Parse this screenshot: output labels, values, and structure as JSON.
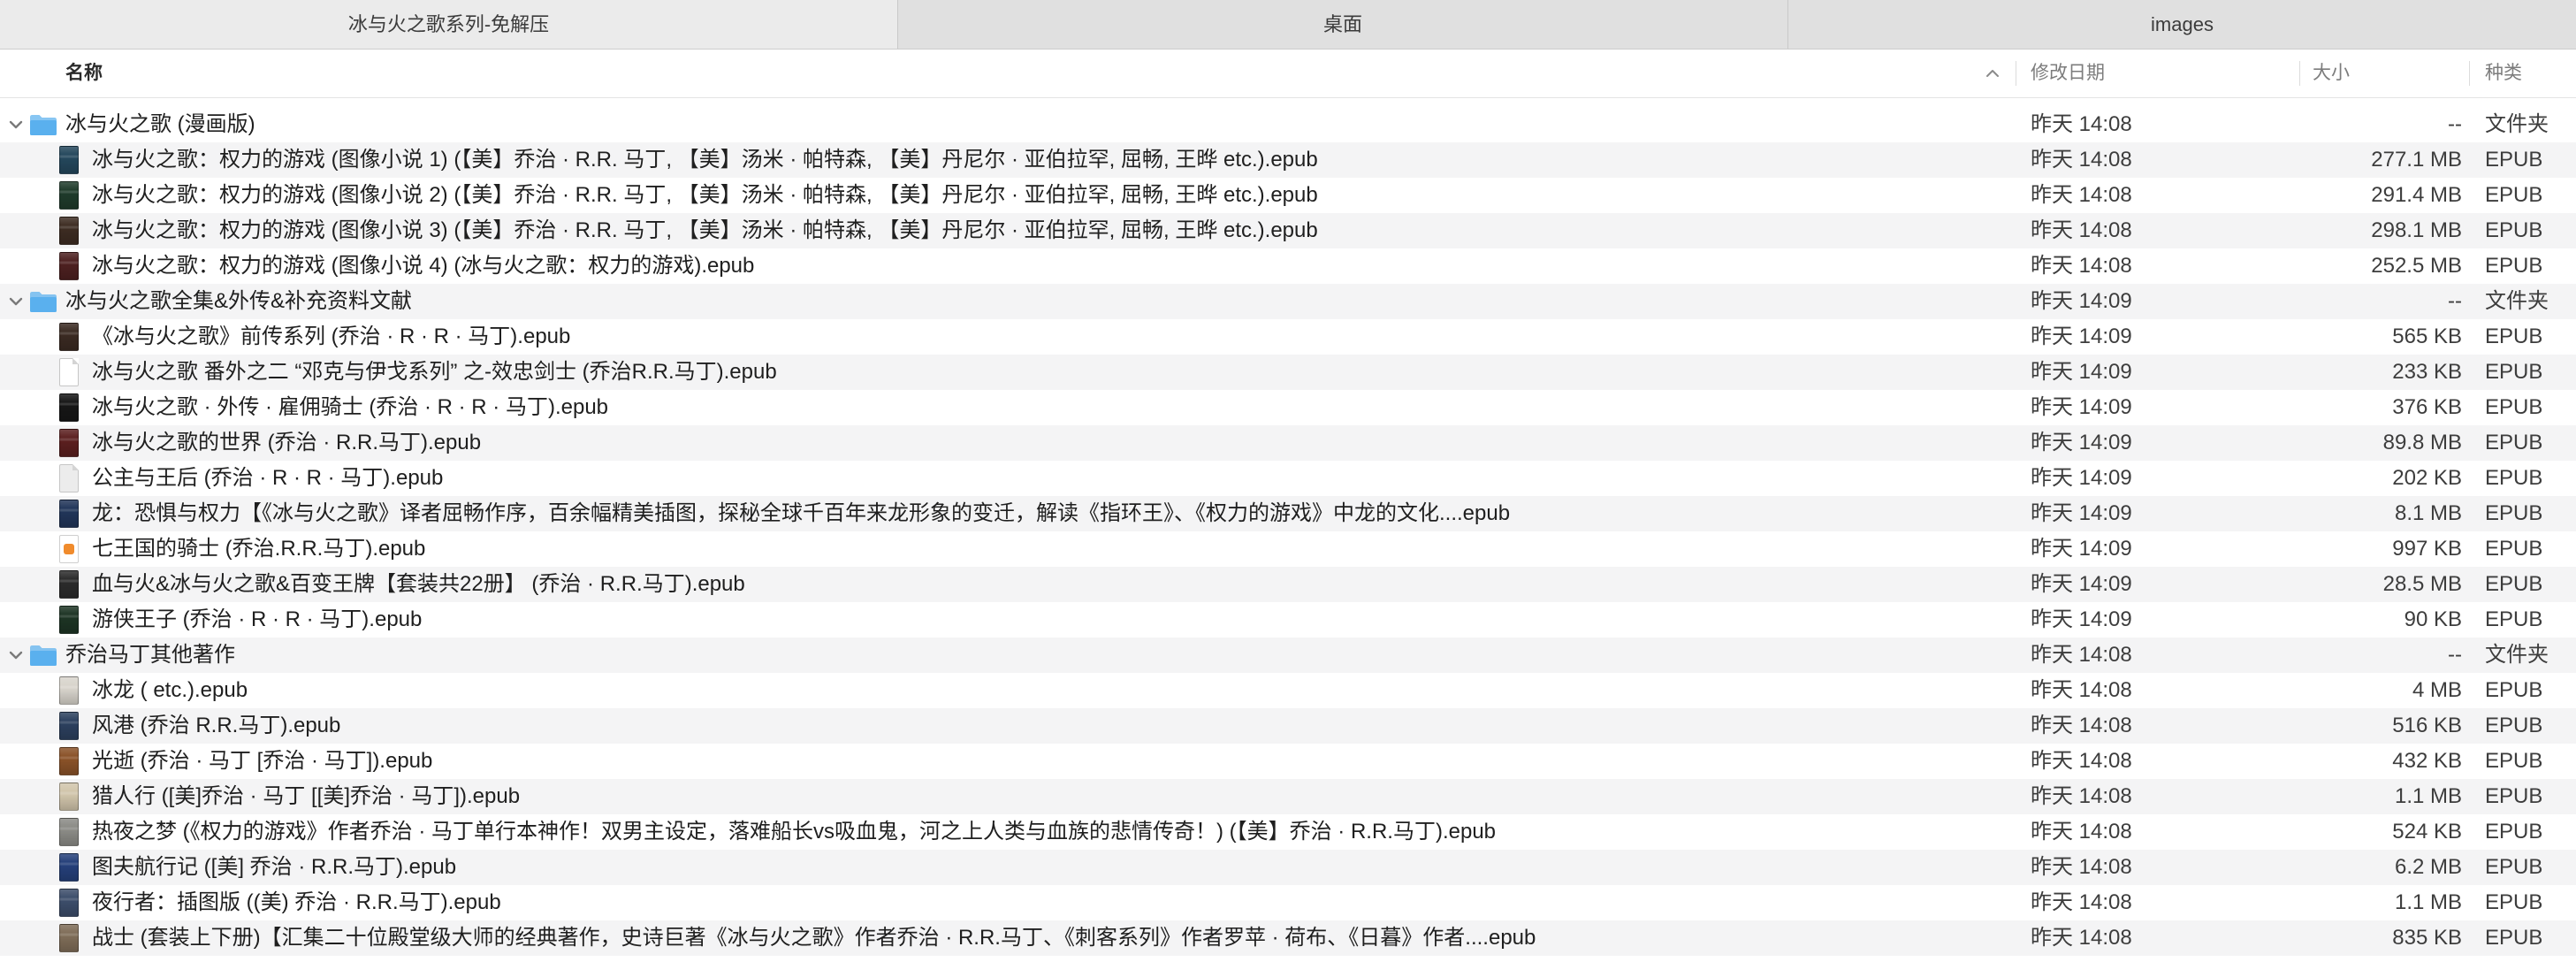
{
  "window": {
    "tabs": [
      {
        "label": "冰与火之歌系列-免解压",
        "active": true
      },
      {
        "label": "桌面",
        "active": false
      },
      {
        "label": "images",
        "active": false
      }
    ]
  },
  "list": {
    "columns": {
      "name": "名称",
      "modified": "修改日期",
      "size": "大小",
      "kind": "种类"
    },
    "sort_icon": "chevron-up-icon",
    "folder_color": "#5ab0ee",
    "rows": [
      {
        "icon": "folder-icon",
        "expanded": true,
        "name": "冰与火之歌 (漫画版)",
        "modified": "昨天 14:08",
        "size": "--",
        "kind": "文件夹"
      },
      {
        "icon": "book-cover-icon",
        "cover": "#24475c",
        "name": "冰与火之歌：权力的游戏 (图像小说 1) (【美】乔治 · R.R. 马丁, 【美】汤米 · 帕特森, 【美】丹尼尔 · 亚伯拉罕, 屈畅, 王晔 etc.).epub",
        "modified": "昨天 14:08",
        "size": "277.1 MB",
        "kind": "EPUB"
      },
      {
        "icon": "book-cover-icon",
        "cover": "#1f3b2b",
        "name": "冰与火之歌：权力的游戏 (图像小说 2) (【美】乔治 · R.R. 马丁, 【美】汤米 · 帕特森, 【美】丹尼尔 · 亚伯拉罕, 屈畅, 王晔 etc.).epub",
        "modified": "昨天 14:08",
        "size": "291.4 MB",
        "kind": "EPUB"
      },
      {
        "icon": "book-cover-icon",
        "cover": "#3d2c22",
        "name": "冰与火之歌：权力的游戏 (图像小说 3) (【美】乔治 · R.R. 马丁, 【美】汤米 · 帕特森, 【美】丹尼尔 · 亚伯拉罕, 屈畅, 王晔 etc.).epub",
        "modified": "昨天 14:08",
        "size": "298.1 MB",
        "kind": "EPUB"
      },
      {
        "icon": "book-cover-icon",
        "cover": "#4d2020",
        "name": "冰与火之歌：权力的游戏 (图像小说 4) (冰与火之歌：权力的游戏).epub",
        "modified": "昨天 14:08",
        "size": "252.5 MB",
        "kind": "EPUB"
      },
      {
        "icon": "folder-icon",
        "expanded": true,
        "name": "冰与火之歌全集&外传&补充资料文献",
        "modified": "昨天 14:09",
        "size": "--",
        "kind": "文件夹"
      },
      {
        "icon": "book-cover-icon",
        "cover": "#3a2a22",
        "name": "《冰与火之歌》前传系列 (乔治 · R · R · 马丁).epub",
        "modified": "昨天 14:09",
        "size": "565 KB",
        "kind": "EPUB"
      },
      {
        "icon": "document-icon",
        "cover": "#ffffff",
        "name": "冰与火之歌 番外之二 “邓克与伊戈系列” 之-效忠剑士 (乔治R.R.马丁).epub",
        "modified": "昨天 14:09",
        "size": "233 KB",
        "kind": "EPUB"
      },
      {
        "icon": "book-cover-icon",
        "cover": "#161616",
        "name": "冰与火之歌 · 外传 · 雇佣骑士 (乔治 · R · R · 马丁).epub",
        "modified": "昨天 14:09",
        "size": "376 KB",
        "kind": "EPUB"
      },
      {
        "icon": "book-cover-icon",
        "cover": "#5b1f1f",
        "name": "冰与火之歌的世界 (乔治 · R.R.马丁).epub",
        "modified": "昨天 14:09",
        "size": "89.8 MB",
        "kind": "EPUB"
      },
      {
        "icon": "document-icon",
        "cover": "#ececec",
        "name": "公主与王后 (乔治 · R · R · 马丁).epub",
        "modified": "昨天 14:09",
        "size": "202 KB",
        "kind": "EPUB"
      },
      {
        "icon": "book-cover-icon",
        "cover": "#213559",
        "name": "龙：恐惧与权力【《冰与火之歌》译者屈畅作序，百余幅精美插图，探秘全球千百年来龙形象的变迁，解读《指环王》、《权力的游戏》中龙的文化....epub",
        "modified": "昨天 14:09",
        "size": "8.1 MB",
        "kind": "EPUB"
      },
      {
        "icon": "epub-icon",
        "accent": "#f08b2c",
        "name": "七王国的骑士 (乔治.R.R.马丁).epub",
        "modified": "昨天 14:09",
        "size": "997 KB",
        "kind": "EPUB"
      },
      {
        "icon": "book-cover-icon",
        "cover": "#2b2b2b",
        "name": "血与火&冰与火之歌&百变王牌【套装共22册】 (乔治 · R.R.马丁).epub",
        "modified": "昨天 14:09",
        "size": "28.5 MB",
        "kind": "EPUB"
      },
      {
        "icon": "book-cover-icon",
        "cover": "#1d3424",
        "name": "游侠王子 (乔治 · R · R · 马丁).epub",
        "modified": "昨天 14:09",
        "size": "90 KB",
        "kind": "EPUB"
      },
      {
        "icon": "folder-icon",
        "expanded": true,
        "name": "乔治马丁其他著作",
        "modified": "昨天 14:08",
        "size": "--",
        "kind": "文件夹"
      },
      {
        "icon": "book-cover-icon",
        "cover": "#d8d4cc",
        "name": "冰龙 ( etc.).epub",
        "modified": "昨天 14:08",
        "size": "4 MB",
        "kind": "EPUB"
      },
      {
        "icon": "book-cover-icon",
        "cover": "#2c405e",
        "name": "风港 (乔治 R.R.马丁).epub",
        "modified": "昨天 14:08",
        "size": "516 KB",
        "kind": "EPUB"
      },
      {
        "icon": "book-cover-icon",
        "cover": "#8a5228",
        "name": "光逝 (乔治 · 马丁 [乔治 · 马丁]).epub",
        "modified": "昨天 14:08",
        "size": "432 KB",
        "kind": "EPUB"
      },
      {
        "icon": "book-cover-icon",
        "cover": "#d1c5ab",
        "name": "猎人行 ([美]乔治 · 马丁 [[美]乔治 · 马丁]).epub",
        "modified": "昨天 14:08",
        "size": "1.1 MB",
        "kind": "EPUB"
      },
      {
        "icon": "book-cover-icon",
        "cover": "#8b8b86",
        "name": "热夜之梦 (《权力的游戏》作者乔治 · 马丁单行本神作！双男主设定，落难船长vs吸血鬼，河之上人类与血族的悲情传奇！) (【美】乔治 · R.R.马丁).epub",
        "modified": "昨天 14:08",
        "size": "524 KB",
        "kind": "EPUB"
      },
      {
        "icon": "book-cover-icon",
        "cover": "#25407a",
        "name": "图夫航行记 ([美] 乔治 · R.R.马丁).epub",
        "modified": "昨天 14:08",
        "size": "6.2 MB",
        "kind": "EPUB"
      },
      {
        "icon": "book-cover-icon",
        "cover": "#3c4d6a",
        "name": "夜行者：插图版 ((美) 乔治 · R.R.马丁).epub",
        "modified": "昨天 14:08",
        "size": "1.1 MB",
        "kind": "EPUB"
      },
      {
        "icon": "book-cover-icon",
        "cover": "#7f6d58",
        "name": "战士 (套装上下册)【汇集二十位殿堂级大师的经典著作，史诗巨著《冰与火之歌》作者乔治 · R.R.马丁、《刺客系列》作者罗苹 · 荷布、《日暮》作者....epub",
        "modified": "昨天 14:08",
        "size": "835 KB",
        "kind": "EPUB"
      }
    ]
  }
}
